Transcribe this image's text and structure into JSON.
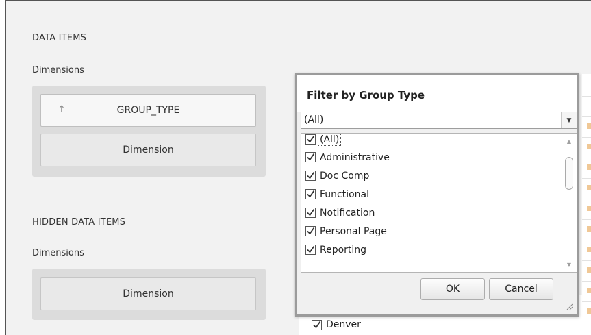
{
  "data_items": {
    "title": "DATA ITEMS",
    "dimensions_label": "Dimensions",
    "group_type_button": "GROUP_TYPE",
    "dimension_placeholder": "Dimension"
  },
  "hidden_data_items": {
    "title": "HIDDEN DATA ITEMS",
    "dimensions_label": "Dimensions",
    "dimension_placeholder": "Dimension"
  },
  "filter_popup": {
    "title": "Filter by Group Type",
    "combo_value": "(All)",
    "items": [
      {
        "label": "(All)",
        "checked": true
      },
      {
        "label": "Administrative",
        "checked": true
      },
      {
        "label": "Doc Comp",
        "checked": true
      },
      {
        "label": "Functional",
        "checked": true
      },
      {
        "label": "Notification",
        "checked": true
      },
      {
        "label": "Personal Page",
        "checked": true
      },
      {
        "label": "Reporting",
        "checked": true
      }
    ],
    "ok_label": "OK",
    "cancel_label": "Cancel"
  },
  "background_list": {
    "visible_item": "Denver"
  },
  "colors": {
    "accent_cell": "#f0c896",
    "popup_border": "#9b9b9b"
  }
}
